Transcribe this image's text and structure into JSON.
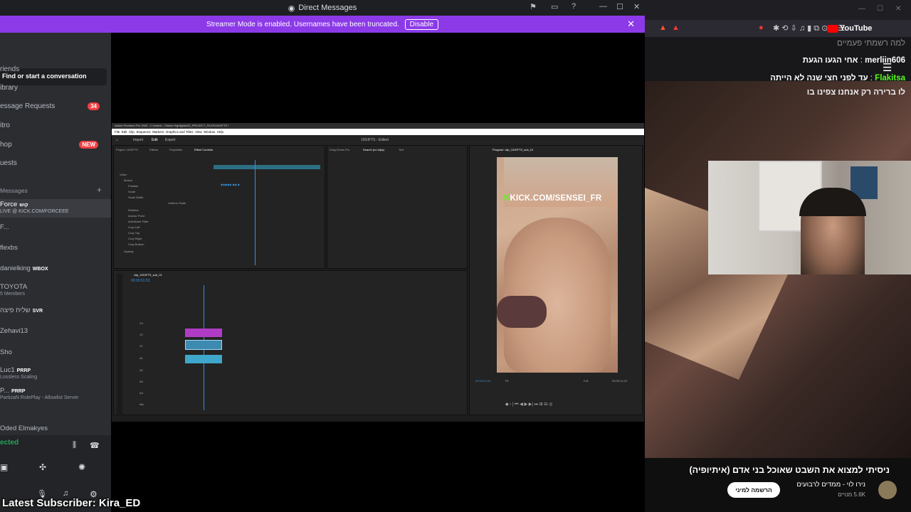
{
  "discord": {
    "window_title": "Direct Messages",
    "banner_text": "Streamer Mode is enabled. Usernames have been truncated.",
    "banner_button": "Disable",
    "search_placeholder": "Find or start a conversation",
    "nav": [
      {
        "label": "riends",
        "badge": ""
      },
      {
        "label": "ibrary",
        "badge": ""
      },
      {
        "label": "essage Requests",
        "badge": "34"
      },
      {
        "label": "itro",
        "badge": ""
      },
      {
        "label": "hop",
        "badge": "NEW"
      },
      {
        "label": "uests",
        "badge": ""
      }
    ],
    "dm_header": "Messages",
    "dms": [
      {
        "name": "Force",
        "tag": "קוש",
        "sub": "LIVE @ KICK.COM/FORCEEE"
      },
      {
        "name": "F...",
        "tag": "",
        "sub": ""
      },
      {
        "name": "flexbs",
        "tag": "",
        "sub": ""
      },
      {
        "name": "danielking",
        "tag": "WBOX",
        "sub": ""
      },
      {
        "name": "TOYOTA",
        "tag": "",
        "sub": "5 Members"
      },
      {
        "name": "שליח פיצה",
        "tag": "SVR",
        "sub": ""
      },
      {
        "name": "Zehavi13",
        "tag": "",
        "sub": ""
      },
      {
        "name": "Sho",
        "tag": "",
        "sub": ""
      },
      {
        "name": "Luc1",
        "tag": "PRRP",
        "sub": "Lossless Scaling"
      },
      {
        "name": "P...",
        "tag": "PRRP",
        "sub": "PartizaN RolePlay - Allowlist Server"
      },
      {
        "name": "Oded Elmakyes",
        "tag": "",
        "sub": ""
      }
    ],
    "voice_status": "ected"
  },
  "premiere": {
    "title": "Adobe Premiere Pro 2025 - C:\\Users\\...\\Twitch Highlights\\03_PROJECT_FILES\\10GIFTS *",
    "menu": [
      "File",
      "Edit",
      "Clip",
      "Sequence",
      "Markers",
      "Graphics and Titles",
      "View",
      "Window",
      "Help"
    ],
    "tabs": [
      "Import",
      "Edit",
      "Export"
    ],
    "project_name": "10GIFTS - Edited",
    "panel_tabs": [
      "Project: 10GIFTS",
      "Effects",
      "Properties",
      "Effect Controls"
    ],
    "effect_rows": [
      "Video",
      "Motion",
      "Position",
      "Scale",
      "Scale Width",
      "Uniform Scale",
      "Rotation",
      "Anchor Point",
      "Anti-flicker Filter",
      "Crop Left",
      "Crop Top",
      "Crop Right",
      "Crop Bottom",
      "Opacity"
    ],
    "source_tabs": [
      "Drag Zones Pro",
      "Search (no clips)",
      "Text"
    ],
    "program_tab": "Program: clip_10GIFTS_sub_01",
    "timecode_left": "00:00:01:53",
    "timecode_right": "00:00:11:23",
    "fit_label": "Fit",
    "full_label": "Full",
    "sequence_tab": "clip_10GIFTS_sub_01",
    "timeline_tc": "00:00:01:53",
    "track_labels": [
      "V3",
      "V2",
      "V1",
      "A1",
      "A2",
      "A3",
      "A4",
      "Mix"
    ],
    "overlay_text_green": "K",
    "overlay_text": "KICK.COM/SENSEI_FR"
  },
  "chat": {
    "line0": "למה רשמתי פעמיים",
    "line1_name": "merliin606",
    "line1_text": "אחי הגעו הגעת",
    "line2_name": "Flakitsa",
    "line2_text": "עד לפני חצי שנה לא הייתה",
    "line3_text": "לו ברירה רק אנחנו צפינו בו"
  },
  "youtube": {
    "logo_text": "YouTube",
    "video_title": "ניסיתי למצוא את השבט שאוכל בני אדם (איתיופיה)",
    "channel": "נירו לוי - ממדים לרבועים",
    "subs": "5.6K מנויים",
    "subscribe": "הרשמה למיני"
  },
  "overlay": {
    "latest_subscriber": "Latest Subscriber: Kira_ED"
  },
  "colors": {
    "banner": "#8c3ae8",
    "kick_green": "#53fc18",
    "badge_red": "#f23f43"
  }
}
